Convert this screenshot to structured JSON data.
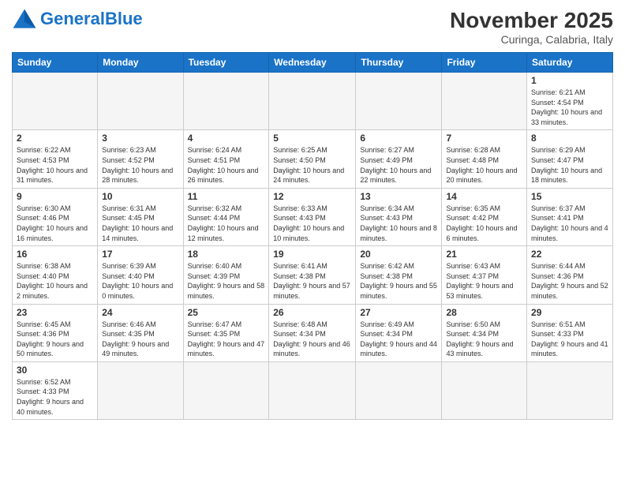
{
  "header": {
    "logo_general": "General",
    "logo_blue": "Blue",
    "month_title": "November 2025",
    "location": "Curinga, Calabria, Italy"
  },
  "weekdays": [
    "Sunday",
    "Monday",
    "Tuesday",
    "Wednesday",
    "Thursday",
    "Friday",
    "Saturday"
  ],
  "weeks": [
    [
      {
        "day": "",
        "info": ""
      },
      {
        "day": "",
        "info": ""
      },
      {
        "day": "",
        "info": ""
      },
      {
        "day": "",
        "info": ""
      },
      {
        "day": "",
        "info": ""
      },
      {
        "day": "",
        "info": ""
      },
      {
        "day": "1",
        "info": "Sunrise: 6:21 AM\nSunset: 4:54 PM\nDaylight: 10 hours and 33 minutes."
      }
    ],
    [
      {
        "day": "2",
        "info": "Sunrise: 6:22 AM\nSunset: 4:53 PM\nDaylight: 10 hours and 31 minutes."
      },
      {
        "day": "3",
        "info": "Sunrise: 6:23 AM\nSunset: 4:52 PM\nDaylight: 10 hours and 28 minutes."
      },
      {
        "day": "4",
        "info": "Sunrise: 6:24 AM\nSunset: 4:51 PM\nDaylight: 10 hours and 26 minutes."
      },
      {
        "day": "5",
        "info": "Sunrise: 6:25 AM\nSunset: 4:50 PM\nDaylight: 10 hours and 24 minutes."
      },
      {
        "day": "6",
        "info": "Sunrise: 6:27 AM\nSunset: 4:49 PM\nDaylight: 10 hours and 22 minutes."
      },
      {
        "day": "7",
        "info": "Sunrise: 6:28 AM\nSunset: 4:48 PM\nDaylight: 10 hours and 20 minutes."
      },
      {
        "day": "8",
        "info": "Sunrise: 6:29 AM\nSunset: 4:47 PM\nDaylight: 10 hours and 18 minutes."
      }
    ],
    [
      {
        "day": "9",
        "info": "Sunrise: 6:30 AM\nSunset: 4:46 PM\nDaylight: 10 hours and 16 minutes."
      },
      {
        "day": "10",
        "info": "Sunrise: 6:31 AM\nSunset: 4:45 PM\nDaylight: 10 hours and 14 minutes."
      },
      {
        "day": "11",
        "info": "Sunrise: 6:32 AM\nSunset: 4:44 PM\nDaylight: 10 hours and 12 minutes."
      },
      {
        "day": "12",
        "info": "Sunrise: 6:33 AM\nSunset: 4:43 PM\nDaylight: 10 hours and 10 minutes."
      },
      {
        "day": "13",
        "info": "Sunrise: 6:34 AM\nSunset: 4:43 PM\nDaylight: 10 hours and 8 minutes."
      },
      {
        "day": "14",
        "info": "Sunrise: 6:35 AM\nSunset: 4:42 PM\nDaylight: 10 hours and 6 minutes."
      },
      {
        "day": "15",
        "info": "Sunrise: 6:37 AM\nSunset: 4:41 PM\nDaylight: 10 hours and 4 minutes."
      }
    ],
    [
      {
        "day": "16",
        "info": "Sunrise: 6:38 AM\nSunset: 4:40 PM\nDaylight: 10 hours and 2 minutes."
      },
      {
        "day": "17",
        "info": "Sunrise: 6:39 AM\nSunset: 4:40 PM\nDaylight: 10 hours and 0 minutes."
      },
      {
        "day": "18",
        "info": "Sunrise: 6:40 AM\nSunset: 4:39 PM\nDaylight: 9 hours and 58 minutes."
      },
      {
        "day": "19",
        "info": "Sunrise: 6:41 AM\nSunset: 4:38 PM\nDaylight: 9 hours and 57 minutes."
      },
      {
        "day": "20",
        "info": "Sunrise: 6:42 AM\nSunset: 4:38 PM\nDaylight: 9 hours and 55 minutes."
      },
      {
        "day": "21",
        "info": "Sunrise: 6:43 AM\nSunset: 4:37 PM\nDaylight: 9 hours and 53 minutes."
      },
      {
        "day": "22",
        "info": "Sunrise: 6:44 AM\nSunset: 4:36 PM\nDaylight: 9 hours and 52 minutes."
      }
    ],
    [
      {
        "day": "23",
        "info": "Sunrise: 6:45 AM\nSunset: 4:36 PM\nDaylight: 9 hours and 50 minutes."
      },
      {
        "day": "24",
        "info": "Sunrise: 6:46 AM\nSunset: 4:35 PM\nDaylight: 9 hours and 49 minutes."
      },
      {
        "day": "25",
        "info": "Sunrise: 6:47 AM\nSunset: 4:35 PM\nDaylight: 9 hours and 47 minutes."
      },
      {
        "day": "26",
        "info": "Sunrise: 6:48 AM\nSunset: 4:34 PM\nDaylight: 9 hours and 46 minutes."
      },
      {
        "day": "27",
        "info": "Sunrise: 6:49 AM\nSunset: 4:34 PM\nDaylight: 9 hours and 44 minutes."
      },
      {
        "day": "28",
        "info": "Sunrise: 6:50 AM\nSunset: 4:34 PM\nDaylight: 9 hours and 43 minutes."
      },
      {
        "day": "29",
        "info": "Sunrise: 6:51 AM\nSunset: 4:33 PM\nDaylight: 9 hours and 41 minutes."
      }
    ],
    [
      {
        "day": "30",
        "info": "Sunrise: 6:52 AM\nSunset: 4:33 PM\nDaylight: 9 hours and 40 minutes."
      },
      {
        "day": "",
        "info": ""
      },
      {
        "day": "",
        "info": ""
      },
      {
        "day": "",
        "info": ""
      },
      {
        "day": "",
        "info": ""
      },
      {
        "day": "",
        "info": ""
      },
      {
        "day": "",
        "info": ""
      }
    ]
  ]
}
